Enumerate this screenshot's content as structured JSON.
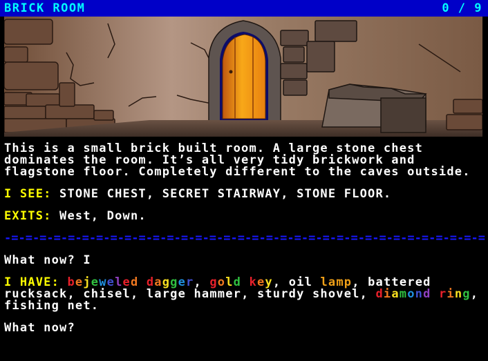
{
  "header": {
    "room_title": "BRICK ROOM",
    "score": "0 / 9"
  },
  "scene": {
    "description": "Pixel art of a brick room with an arched glowing orange door and a large stone chest",
    "colors": {
      "wall": "#8a6a52",
      "wall_light": "#b89a82",
      "brick": "#6a5448",
      "brick_dark": "#3a2a22",
      "door": "#f0a020",
      "door_glow": "#ffcc40",
      "door_frame": "#1a1a80",
      "floor": "#5a463a",
      "chest": "#6e5e54"
    }
  },
  "description": "This is a small brick built room. A large stone chest dominates the room. It’s all very tidy brickwork and flagstone floor. Completely different to the caves outside.",
  "see": {
    "label": "I SEE:",
    "items": "STONE CHEST, SECRET STAIRWAY, STONE FLOOR."
  },
  "exits": {
    "label": "EXITS:",
    "value": "West, Down."
  },
  "divider": "-=-=-=-=-=-=-=-=-=-=-=-=-=-=-=-=-=-=-=-=-=-=-=-=-=-=-=-=-=-=-=-=-=-=-=-=-=-=-=-=-=-=-=-=-=-=-=-=",
  "history": {
    "prompt": "What now?",
    "command": "I"
  },
  "inventory": {
    "label": "I HAVE:",
    "items": [
      {
        "text": "bejeweled dagger",
        "style": "rainbow"
      },
      {
        "text": "gold key",
        "style": "rainbow"
      },
      {
        "text": "oil",
        "style": "plain"
      },
      {
        "text": "lamp",
        "style": "lamp",
        "prefix": " "
      },
      {
        "text": "battered rucksack",
        "style": "plain"
      },
      {
        "text": "chisel",
        "style": "plain"
      },
      {
        "text": "large hammer",
        "style": "plain"
      },
      {
        "text": "sturdy shovel",
        "style": "plain"
      },
      {
        "text": "diamond ring",
        "style": "rainbow"
      },
      {
        "text": "fishing net",
        "style": "plain"
      }
    ],
    "rainbow_colors": [
      "#e8202a",
      "#f07820",
      "#f8e020",
      "#30c040",
      "#2090e0",
      "#4050d0",
      "#9040c0"
    ],
    "lamp_color": "#f0a018"
  },
  "input": {
    "prompt": "What now?",
    "value": ""
  }
}
